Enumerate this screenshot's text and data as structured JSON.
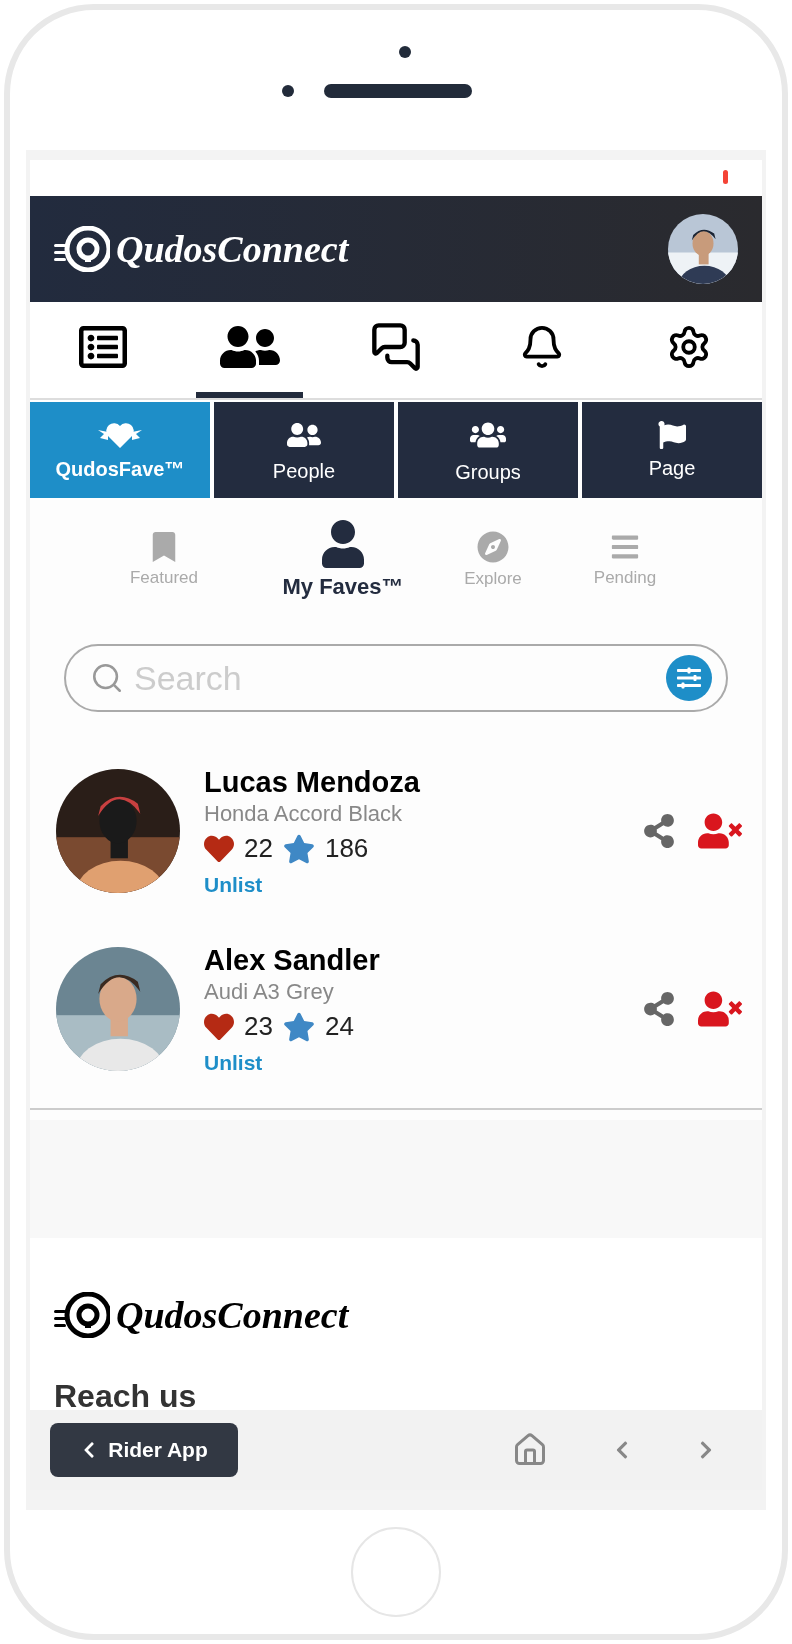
{
  "header": {
    "logo_text": "QudosConnect"
  },
  "main_tabs": [
    {
      "kind": "list",
      "selected": false
    },
    {
      "kind": "people",
      "selected": true
    },
    {
      "kind": "chat",
      "selected": false
    },
    {
      "kind": "bell",
      "selected": false
    },
    {
      "kind": "gear",
      "selected": false
    }
  ],
  "category_tabs": [
    {
      "kind": "fave",
      "label": "QudosFave™",
      "selected": true
    },
    {
      "kind": "people",
      "label": "People",
      "selected": false
    },
    {
      "kind": "groups",
      "label": "Groups",
      "selected": false
    },
    {
      "kind": "flag",
      "label": "Page",
      "selected": false
    }
  ],
  "sub_tabs": [
    {
      "kind": "bookmark",
      "label": "Featured",
      "selected": false
    },
    {
      "kind": "user",
      "label": "My Faves™",
      "selected": true
    },
    {
      "kind": "compass",
      "label": "Explore",
      "selected": false
    },
    {
      "kind": "bars",
      "label": "Pending",
      "selected": false
    }
  ],
  "search": {
    "placeholder": "Search"
  },
  "faves": [
    {
      "name": "Lucas Mendoza",
      "vehicle": "Honda Accord Black",
      "likes": "22",
      "rating": "186",
      "action": "Unlist"
    },
    {
      "name": "Alex Sandler",
      "vehicle": "Audi A3 Grey",
      "likes": "23",
      "rating": "24",
      "action": "Unlist"
    }
  ],
  "footer": {
    "logo_text": "QudosConnect",
    "heading": "Reach us"
  },
  "bottom_bar": {
    "back_button": "Rider App"
  }
}
